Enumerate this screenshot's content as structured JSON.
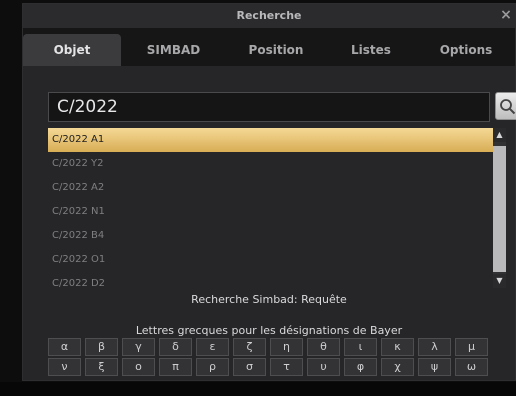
{
  "window": {
    "title": "Recherche",
    "close": "×"
  },
  "tabs": [
    {
      "label": "Objet",
      "active": true
    },
    {
      "label": "SIMBAD",
      "active": false
    },
    {
      "label": "Position",
      "active": false
    },
    {
      "label": "Listes",
      "active": false
    },
    {
      "label": "Options",
      "active": false
    }
  ],
  "search": {
    "value": "C/2022",
    "button_icon": "search-icon"
  },
  "results": [
    {
      "label": "C/2022 A1",
      "selected": true
    },
    {
      "label": "C/2022 Y2",
      "selected": false
    },
    {
      "label": "C/2022 A2",
      "selected": false
    },
    {
      "label": "C/2022 N1",
      "selected": false
    },
    {
      "label": "C/2022 B4",
      "selected": false
    },
    {
      "label": "C/2022 O1",
      "selected": false
    },
    {
      "label": "C/2022 D2",
      "selected": false
    }
  ],
  "simbad_status": "Recherche Simbad: Requête",
  "greek": {
    "label": "Lettres grecques pour les désignations de Bayer",
    "row1": [
      "α",
      "β",
      "γ",
      "δ",
      "ε",
      "ζ",
      "η",
      "θ",
      "ι",
      "κ",
      "λ",
      "μ"
    ],
    "row2": [
      "ν",
      "ξ",
      "ο",
      "π",
      "ρ",
      "σ",
      "τ",
      "υ",
      "φ",
      "χ",
      "ψ",
      "ω"
    ]
  },
  "colors": {
    "selection": "#e8c070",
    "background": "#262628"
  }
}
